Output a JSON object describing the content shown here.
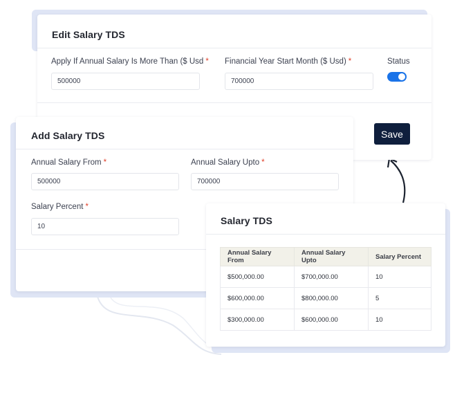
{
  "edit_card": {
    "title": "Edit Salary TDS",
    "apply_label": "Apply If Annual Salary Is More Than ($ Usd",
    "apply_value": "500000",
    "fy_label": "Financial Year Start Month ($ Usd)",
    "fy_value": "700000",
    "status_label": "Status",
    "status_on": true,
    "save_label": "Save",
    "required_mark": "*"
  },
  "add_card": {
    "title": "Add Salary TDS",
    "from_label": "Annual Salary From",
    "from_value": "500000",
    "upto_label": "Annual Salary Upto",
    "upto_value": "700000",
    "percent_label": "Salary Percent",
    "percent_value": "10",
    "required_mark": "*"
  },
  "table_card": {
    "title": "Salary TDS",
    "headers": [
      "Annual Salary From",
      "Annual Salary Upto",
      "Salary Percent"
    ],
    "rows": [
      [
        "$500,000.00",
        "$700,000.00",
        "10"
      ],
      [
        "$600,000.00",
        "$800,000.00",
        "5"
      ],
      [
        "$300,000.00",
        "$600,000.00",
        "10"
      ]
    ]
  },
  "colors": {
    "accent": "#1a73e8",
    "save_button": "#0f1f3d",
    "required": "#e0412b",
    "shadow_plate": "#dfe5f5"
  }
}
